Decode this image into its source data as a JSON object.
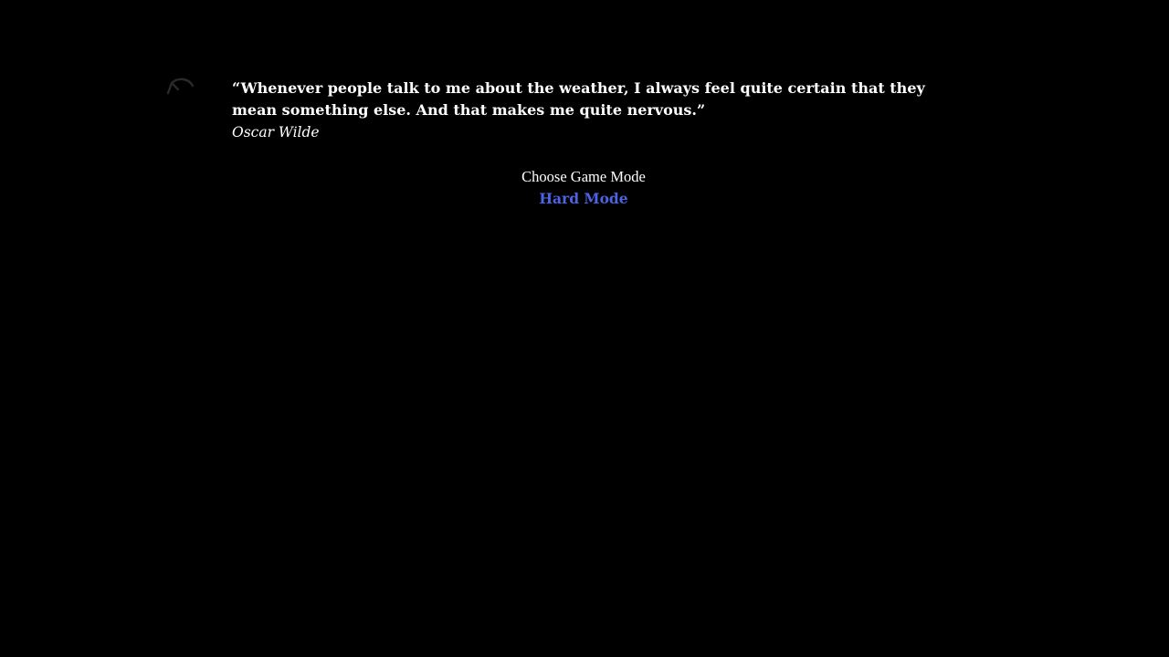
{
  "quote": {
    "text": "“Whenever people talk to me about the weather, I always feel quite certain that they mean something else. And that makes me quite nervous.”",
    "author": "Oscar Wilde"
  },
  "game_mode": {
    "title": "Choose Game Mode",
    "options": [
      {
        "label": "Hard Mode"
      }
    ]
  },
  "controls": {
    "undo_icon": "undo-arrow-icon"
  },
  "colors": {
    "background": "#000000",
    "text": "#ffffff",
    "link": "#4c63e6",
    "icon": "#2a2a2a"
  }
}
